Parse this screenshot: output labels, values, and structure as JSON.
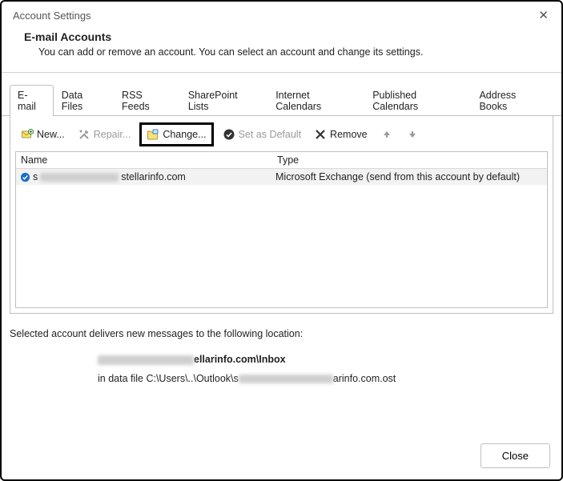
{
  "window": {
    "title": "Account Settings",
    "close_aria": "Close"
  },
  "header": {
    "title": "E-mail Accounts",
    "desc": "You can add or remove an account. You can select an account and change its settings."
  },
  "tabs": [
    {
      "label": "E-mail",
      "active": true
    },
    {
      "label": "Data Files"
    },
    {
      "label": "RSS Feeds"
    },
    {
      "label": "SharePoint Lists"
    },
    {
      "label": "Internet Calendars"
    },
    {
      "label": "Published Calendars"
    },
    {
      "label": "Address Books"
    }
  ],
  "toolbar": {
    "new_label": "New...",
    "repair_label": "Repair...",
    "change_label": "Change...",
    "default_label": "Set as Default",
    "remove_label": "Remove"
  },
  "table": {
    "col_name": "Name",
    "col_type": "Type",
    "row": {
      "name_prefix": "s",
      "name_suffix": "stellarinfo.com",
      "type": "Microsoft Exchange (send from this account by default)"
    }
  },
  "footer": {
    "line1": "Selected account delivers new messages to the following location:",
    "account_suffix": "ellarinfo.com\\Inbox",
    "path_prefix": "in data file C:\\Users\\..\\Outlook\\s",
    "path_suffix": "arinfo.com.ost",
    "close_btn": "Close"
  }
}
